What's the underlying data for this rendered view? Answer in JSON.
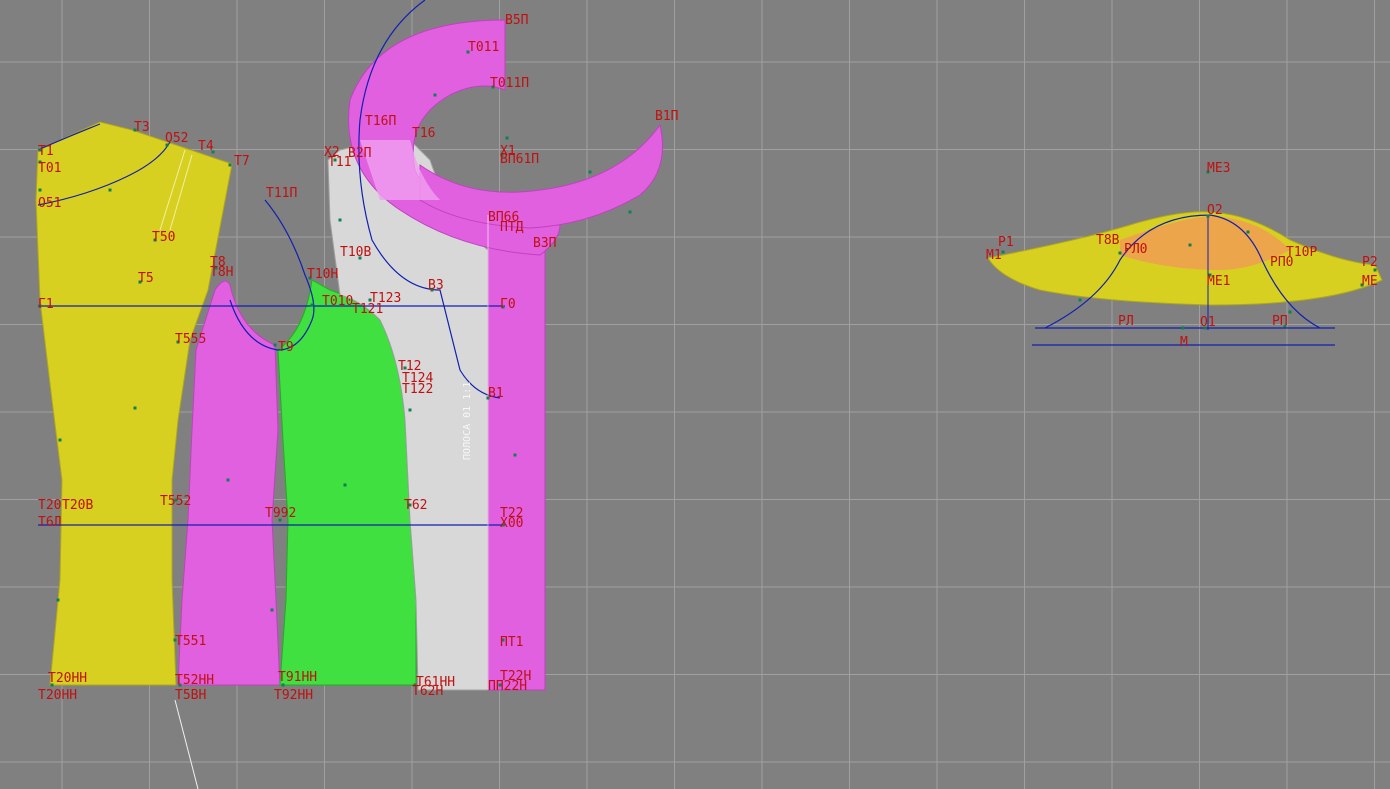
{
  "colors": {
    "background": "#808080",
    "grid": "#a0a0a0",
    "yellow_piece": "#d8d020",
    "magenta_piece": "#e060e0",
    "green_piece": "#40e040",
    "white_piece": "#d8d8d8",
    "orange_fill": "#f0a050",
    "label_red": "#c01010",
    "line_blue": "#1020b0"
  },
  "labels": {
    "b5p": "В5П",
    "t011": "Т011",
    "t011p": "Т011П",
    "b1p": "В1П",
    "t16p": "Т16П",
    "t16": "Т16",
    "x1": "Х1",
    "vp61p": "ВП61П",
    "t3": "Т3",
    "o52": "О52",
    "t4": "Т4",
    "t7": "Т7",
    "t1": "Т1",
    "t01": "Т01",
    "o51": "О51",
    "x2": "Х2",
    "b2p": "В2П",
    "t11": "Т11",
    "t11p": "Т11П",
    "t50": "Т50",
    "t8": "Т8",
    "t8n": "Т8Н",
    "t5": "Т5",
    "t10n": "Т10Н",
    "t10b": "Т10В",
    "b3": "В3",
    "vp66": "ВП66",
    "ptd": "ПТД",
    "b3p": "В3П",
    "g1": "Г1",
    "t010": "Т010",
    "t123": "Т123",
    "t121": "Т121",
    "g0": "Г0",
    "t555": "Т555",
    "t9": "Т9",
    "t12": "Т12",
    "t124": "Т124",
    "t122": "Т122",
    "b1": "В1",
    "t20": "Т20",
    "t20b": "Т20В",
    "t552": "Т552",
    "t992": "Т992",
    "t62": "Т62",
    "t22": "Т22",
    "t6l": "Т6Л",
    "x00": "Х00",
    "t551": "Т551",
    "pt1": "ПТ1",
    "t20nn": "Т20НН",
    "t52nn": "Т52НН",
    "t91nn": "Т91НН",
    "t61nn": "Т61НН",
    "t22n": "Т22Н",
    "t20n": "Т20НН",
    "t5bn": "Т5ВН",
    "t92nn": "Т92НН",
    "t62n": "Т62Н",
    "ppbbn": "ПП22Н",
    "me3": "МЕ3",
    "o2": "О2",
    "p1": "Р1",
    "m1": "М1",
    "t8b": "Т8В",
    "pl0": "РЛ0",
    "t10r": "Т10Р",
    "rp0": "РП0",
    "p2": "Р2",
    "me1": "МЕ1",
    "me2": "МЕ",
    "rl": "РЛ",
    "o1": "О1",
    "rp": "РП",
    "m": "М",
    "vertical_text": "ПОЛОСА 01 1:1"
  }
}
